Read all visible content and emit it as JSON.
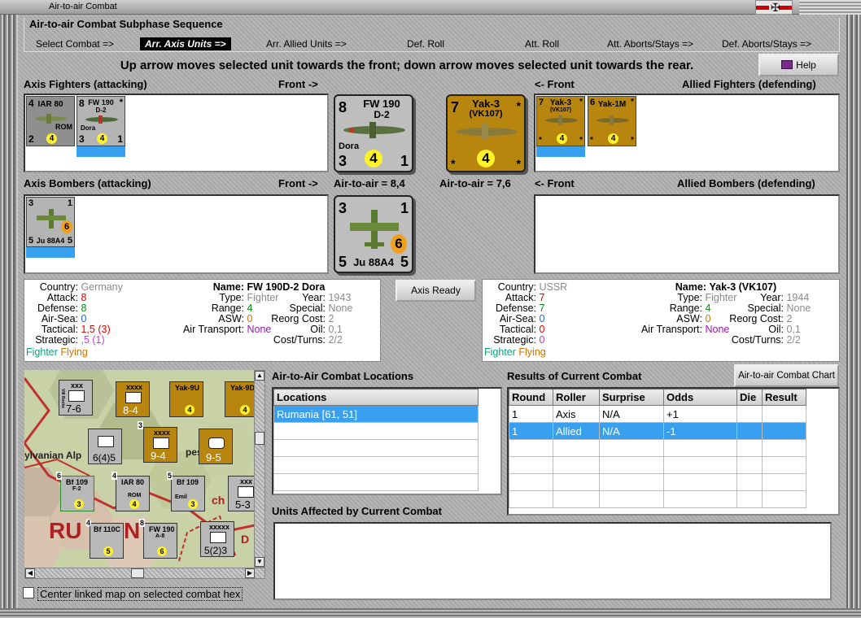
{
  "window": {
    "title": "Air-to-air Combat"
  },
  "sequence": {
    "title": "Air-to-air Combat Subphase Sequence",
    "steps": [
      "Select Combat =>",
      "Arr. Axis Units =>",
      "Arr. Allied Units =>",
      "Def. Roll",
      "Att. Roll",
      "Att. Aborts/Stays =>",
      "Def. Aborts/Stays =>"
    ],
    "active": "Arr. Axis Units =>"
  },
  "instruction": "Up arrow moves selected unit towards the front; down arrow moves selected unit towards the rear.",
  "help_button": "Help",
  "axis_fighters": {
    "label": "Axis Fighters (attacking)",
    "front": "Front ->",
    "units": [
      {
        "tl": "4",
        "name": "IAR 80",
        "br": "ROM",
        "bl": "2",
        "circle": "4",
        "br2": ""
      },
      {
        "tl": "8",
        "name": "FW 190",
        "sub": "D-2",
        "tr": "*",
        "bl": "3",
        "circle": "4",
        "br2": "1",
        "extra": "Dora"
      }
    ]
  },
  "allied_fighters": {
    "label": "Allied Fighters (defending)",
    "front": "<- Front",
    "units": [
      {
        "tl": "7",
        "name": "Yak-3",
        "sub": "(VK107)",
        "tr": "*",
        "bl": "*",
        "circle": "4",
        "br": "*"
      },
      {
        "tl": "6",
        "name": "Yak-1M",
        "tr": "*",
        "bl": "*",
        "circle": "4",
        "br": "*"
      }
    ]
  },
  "axis_bombers": {
    "label": "Axis Bombers (attacking)",
    "front": "Front ->",
    "units": [
      {
        "tl": "3",
        "tr": "1",
        "circle": "6",
        "bl": "5",
        "name": "Ju 88A4",
        "br": "5"
      }
    ]
  },
  "allied_bombers": {
    "label": "Allied Bombers (defending)",
    "front": "<- Front"
  },
  "selected_axis": {
    "tl": "8",
    "name": "FW 190",
    "sub": "D-2",
    "extra": "Dora",
    "bl": "3",
    "circle": "4",
    "br": "1",
    "air_to_air": "Air-to-air = 8,4"
  },
  "selected_allied": {
    "tl": "7",
    "name": "Yak-3",
    "sub": "(VK107)",
    "tr": "*",
    "bl": "*",
    "circle": "4",
    "br": "*",
    "air_to_air": "Air-to-air = 7,6"
  },
  "selected_bomber": {
    "tl": "3",
    "tr": "1",
    "circle": "6",
    "bl": "5",
    "name": "Ju 88A4",
    "br": "5"
  },
  "axis_ready_button": "Axis Ready",
  "axis_info": {
    "country_k": "Country:",
    "country": "Germany",
    "attack_k": "Attack:",
    "attack": "8",
    "defense_k": "Defense:",
    "defense": "8",
    "airsea_k": "Air-Sea:",
    "airsea": "0",
    "tactical_k": "Tactical:",
    "tactical": "1,5 (3)",
    "strategic_k": "Strategic:",
    "strategic": ",5 (1)",
    "tag1": "Fighter",
    "tag2": "Flying",
    "name_k": "Name:",
    "name": "FW 190D-2 Dora",
    "type_k": "Type:",
    "type": "Fighter",
    "range_k": "Range:",
    "range": "4",
    "asw_k": "ASW:",
    "asw": "0",
    "airtrans_k": "Air Transport:",
    "airtrans": "None",
    "year_k": "Year:",
    "year": "1943",
    "special_k": "Special:",
    "special": "None",
    "reorg_k": "Reorg Cost:",
    "reorg": "2",
    "oil_k": "Oil:",
    "oil": "0,1",
    "cost_k": "Cost/Turns:",
    "cost": "2/2"
  },
  "allied_info": {
    "country_k": "Country:",
    "country": "USSR",
    "attack_k": "Attack:",
    "attack": "7",
    "defense_k": "Defense:",
    "defense": "7",
    "airsea_k": "Air-Sea:",
    "airsea": "0",
    "tactical_k": "Tactical:",
    "tactical": "0",
    "strategic_k": "Strategic:",
    "strategic": "0",
    "tag1": "Fighter",
    "tag2": "Flying",
    "name_k": "Name:",
    "name": "Yak-3 (VK107)",
    "type_k": "Type:",
    "type": "Fighter",
    "range_k": "Range:",
    "range": "4",
    "asw_k": "ASW:",
    "asw": "0",
    "airtrans_k": "Air Transport:",
    "airtrans": "None",
    "year_k": "Year:",
    "year": "1944",
    "special_k": "Special:",
    "special": "None",
    "reorg_k": "Reorg Cost:",
    "reorg": "2",
    "oil_k": "Oil:",
    "oil": "0,1",
    "cost_k": "Cost/Turns:",
    "cost": "2/2"
  },
  "locations": {
    "title": "Air-to-Air Combat Locations",
    "header": "Locations",
    "rows": [
      "Rumania [61, 51]"
    ]
  },
  "results": {
    "title": "Results of Current Combat",
    "chart_button": "Air-to-air Combat Chart",
    "headers": [
      "Round",
      "Roller",
      "Surprise",
      "Odds",
      "Die",
      "Result"
    ],
    "rows": [
      [
        "1",
        "Axis",
        "N/A",
        "+1",
        "",
        ""
      ],
      [
        "1",
        "Allied",
        "N/A",
        "-1",
        "",
        ""
      ]
    ]
  },
  "affected": {
    "title": "Units Affected by Current Combat"
  },
  "center_map": {
    "label": "Center linked map on selected combat hex"
  },
  "map": {
    "region_labels": [
      "ylvanian Alp",
      "pes",
      "RU",
      "N",
      "ch",
      "D"
    ],
    "units": [
      {
        "top": "xxx",
        "mid": "VIII Rocks",
        "val": "7-6"
      },
      {
        "top": "xxxx",
        "val": "8-4"
      },
      {
        "top": "",
        "name": "Yak-9U",
        "circle": "4"
      },
      {
        "top": "",
        "name": "Yak-9D",
        "circle": "4"
      },
      {
        "top": "",
        "val": "6(4)5"
      },
      {
        "top": "xxxx",
        "val": "9-4",
        "num": "3"
      },
      {
        "top": "",
        "val": "9-5"
      },
      {
        "name": "Bf 109",
        "sub": "F-2",
        "circle": "3",
        "num": "6"
      },
      {
        "name": "IAR 80",
        "sub": "ROM",
        "circle": "4",
        "num": "4"
      },
      {
        "name": "Bf 109",
        "sub": "Emil",
        "circle": "3",
        "num": "5"
      },
      {
        "top": "xxx",
        "val": "5-3"
      },
      {
        "name": "Bf 110C",
        "circle": "5",
        "num": "4"
      },
      {
        "name": "FW 190",
        "sub": "A-8",
        "circle": "6",
        "num": "8"
      },
      {
        "top": "xxxxx",
        "val": "5(2)3"
      }
    ]
  }
}
